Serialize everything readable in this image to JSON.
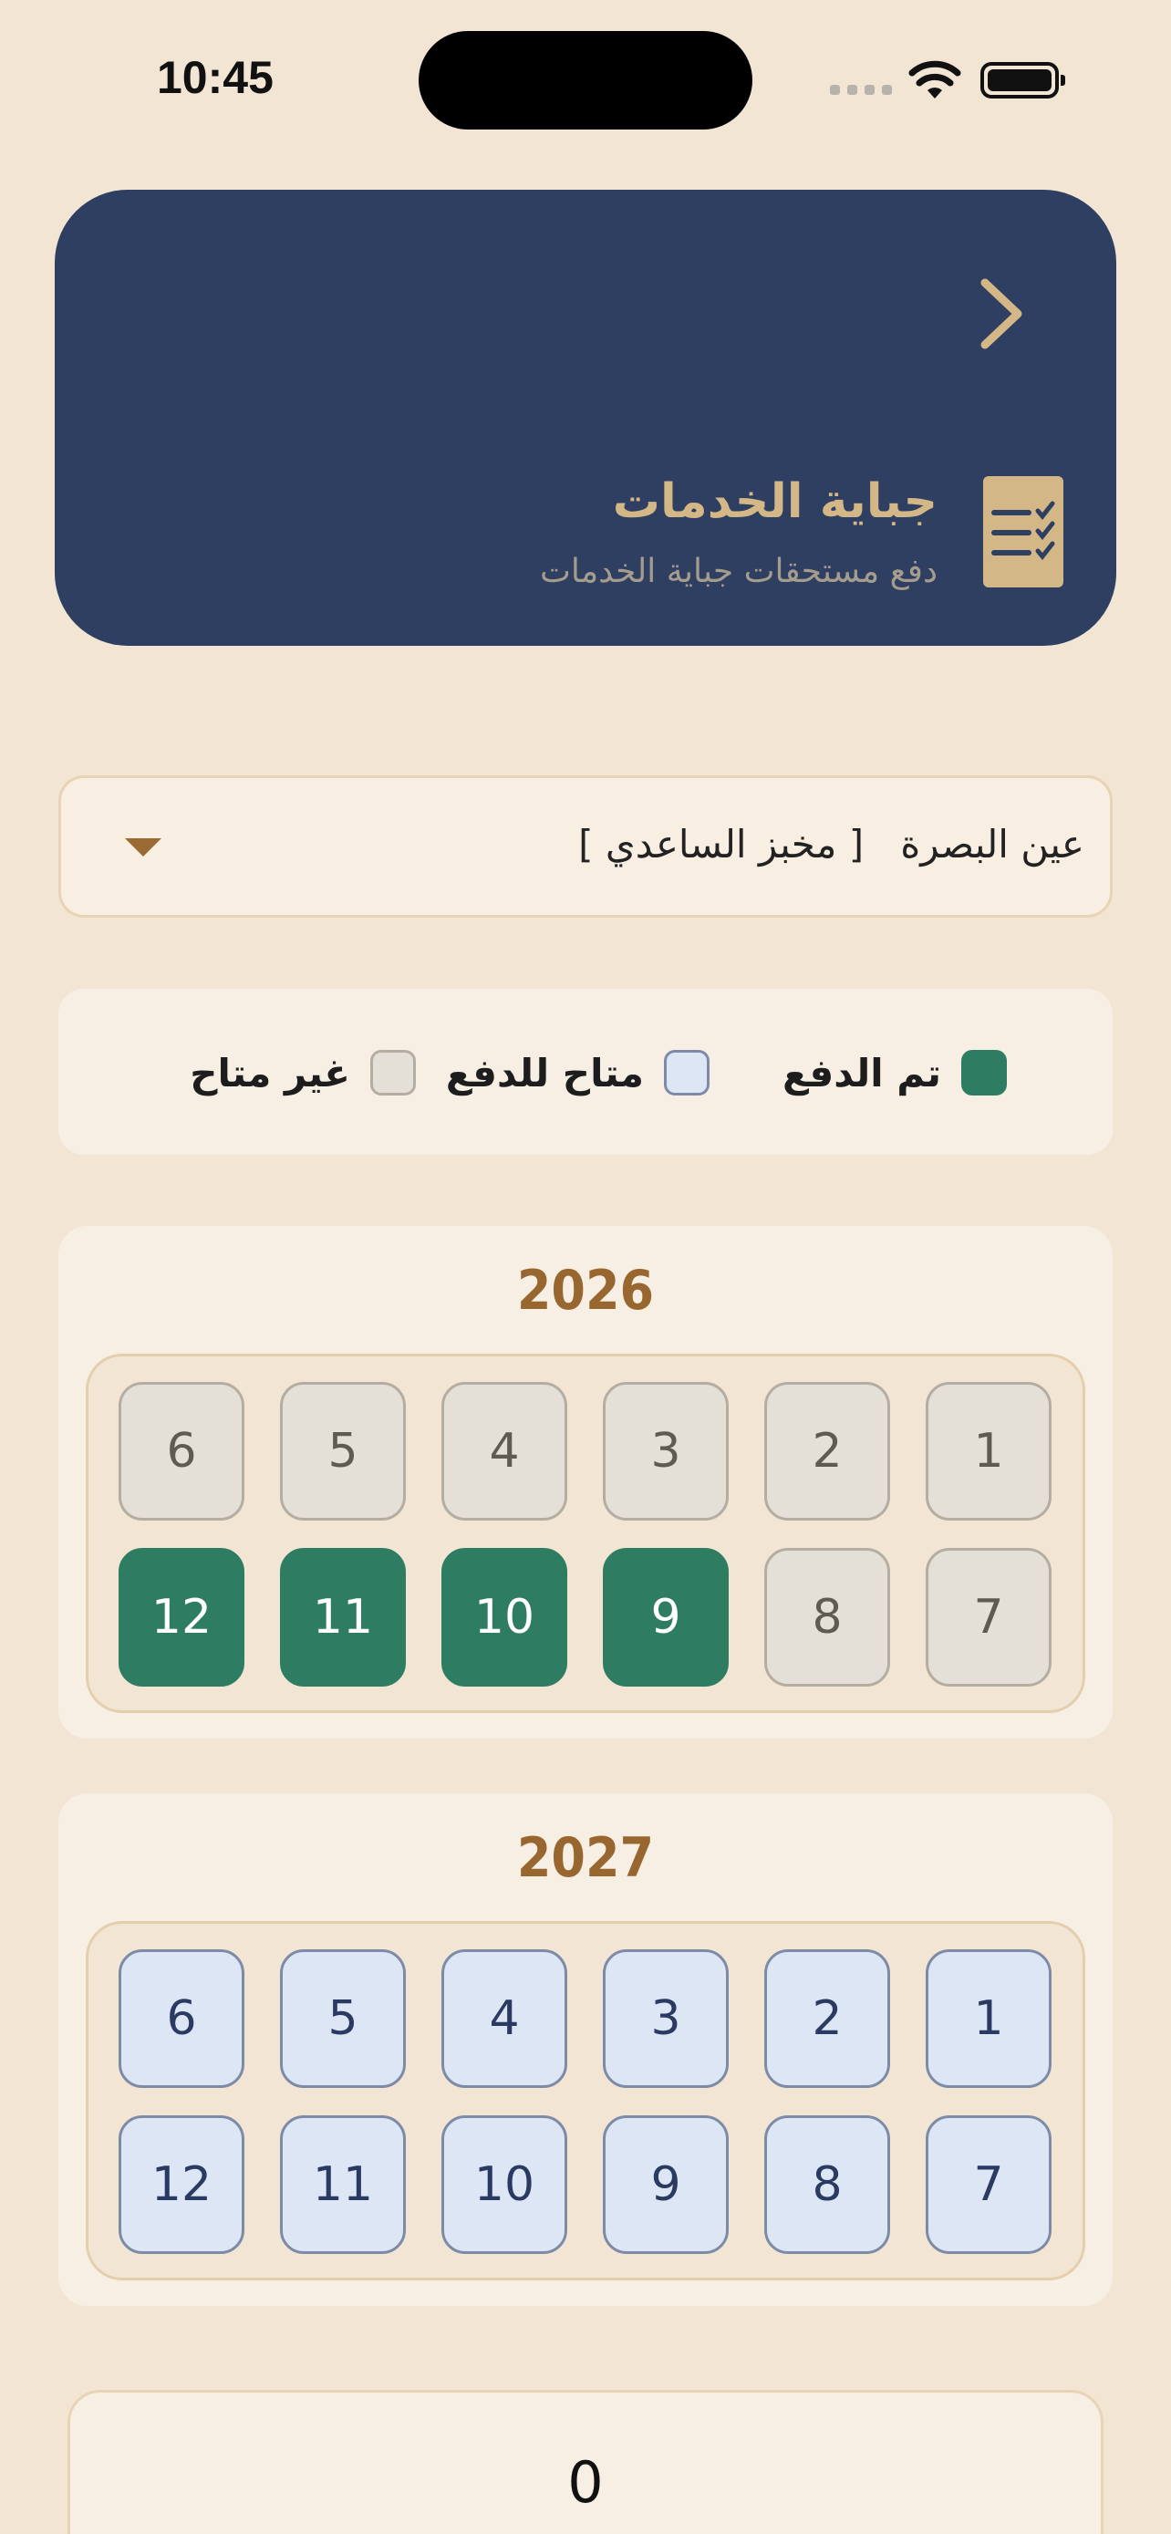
{
  "status_bar": {
    "time": "10:45"
  },
  "header": {
    "title": "جباية الخدمات",
    "subtitle": "دفع مستحقات جباية الخدمات",
    "icon": "checklist-icon",
    "nav_icon": "chevron-right-icon",
    "background": "#2E3F62",
    "accent": "#D3B786"
  },
  "location_select": {
    "selected": "عين البصرة   [ مخبز الساعدي ]"
  },
  "legend": [
    {
      "label": "تم الدفع",
      "status": "paid",
      "color": "#2E7D63"
    },
    {
      "label": "متاح للدفع",
      "status": "available",
      "color": "#DCE6F4"
    },
    {
      "label": "غير متاح",
      "status": "unavailable",
      "color": "#E4E0D8"
    }
  ],
  "years": [
    {
      "year": "2026",
      "months": [
        {
          "label": "1",
          "status": "unavailable"
        },
        {
          "label": "2",
          "status": "unavailable"
        },
        {
          "label": "3",
          "status": "unavailable"
        },
        {
          "label": "4",
          "status": "unavailable"
        },
        {
          "label": "5",
          "status": "unavailable"
        },
        {
          "label": "6",
          "status": "unavailable"
        },
        {
          "label": "7",
          "status": "unavailable"
        },
        {
          "label": "8",
          "status": "unavailable"
        },
        {
          "label": "9",
          "status": "paid"
        },
        {
          "label": "10",
          "status": "paid"
        },
        {
          "label": "11",
          "status": "paid"
        },
        {
          "label": "12",
          "status": "paid"
        }
      ]
    },
    {
      "year": "2027",
      "months": [
        {
          "label": "1",
          "status": "available"
        },
        {
          "label": "2",
          "status": "available"
        },
        {
          "label": "3",
          "status": "available"
        },
        {
          "label": "4",
          "status": "available"
        },
        {
          "label": "5",
          "status": "available"
        },
        {
          "label": "6",
          "status": "available"
        },
        {
          "label": "7",
          "status": "available"
        },
        {
          "label": "8",
          "status": "available"
        },
        {
          "label": "9",
          "status": "available"
        },
        {
          "label": "10",
          "status": "available"
        },
        {
          "label": "11",
          "status": "available"
        },
        {
          "label": "12",
          "status": "available"
        }
      ]
    }
  ],
  "total": {
    "value": "0"
  }
}
